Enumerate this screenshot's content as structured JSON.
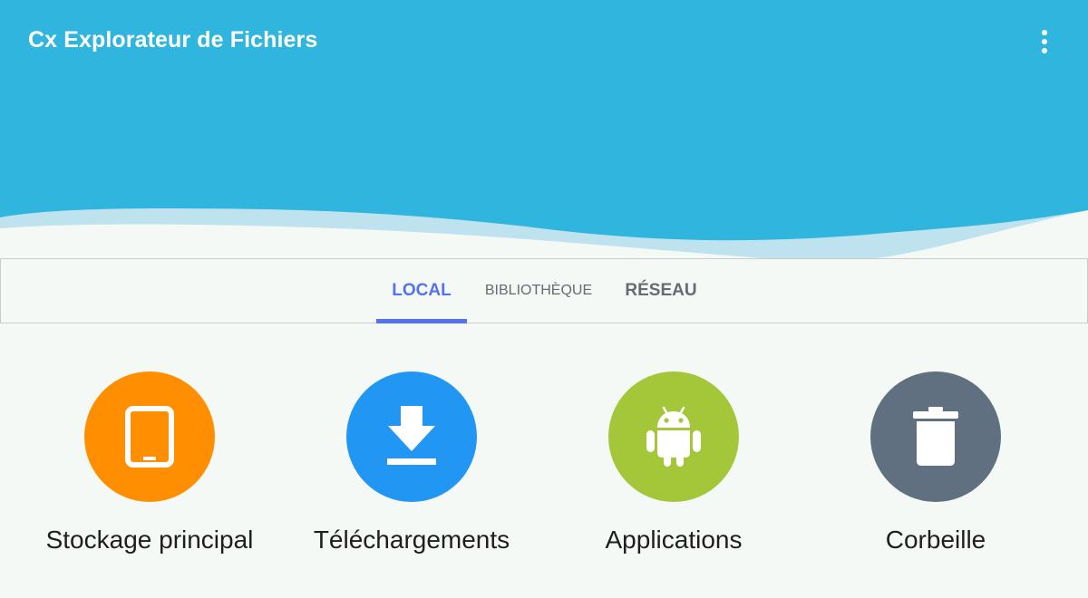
{
  "app": {
    "title": "Cx Explorateur de Fichiers",
    "header_color": "#30b6de",
    "background_color": "#f4f9f6",
    "menu_icon": "more-vertical-icon"
  },
  "tabs": [
    {
      "label": "LOCAL",
      "active": true
    },
    {
      "label": "BIBLIOTHÈQUE",
      "active": false
    },
    {
      "label": "RÉSEAU",
      "active": false
    }
  ],
  "accent_color": "#5472ee",
  "shortcuts": [
    {
      "label": "Stockage principal",
      "icon": "tablet-icon",
      "color": "#ff8f00"
    },
    {
      "label": "Téléchargements",
      "icon": "download-icon",
      "color": "#2196f3"
    },
    {
      "label": "Applications",
      "icon": "android-icon",
      "color": "#a4c639"
    },
    {
      "label": "Corbeille",
      "icon": "trash-icon",
      "color": "#607080"
    }
  ]
}
